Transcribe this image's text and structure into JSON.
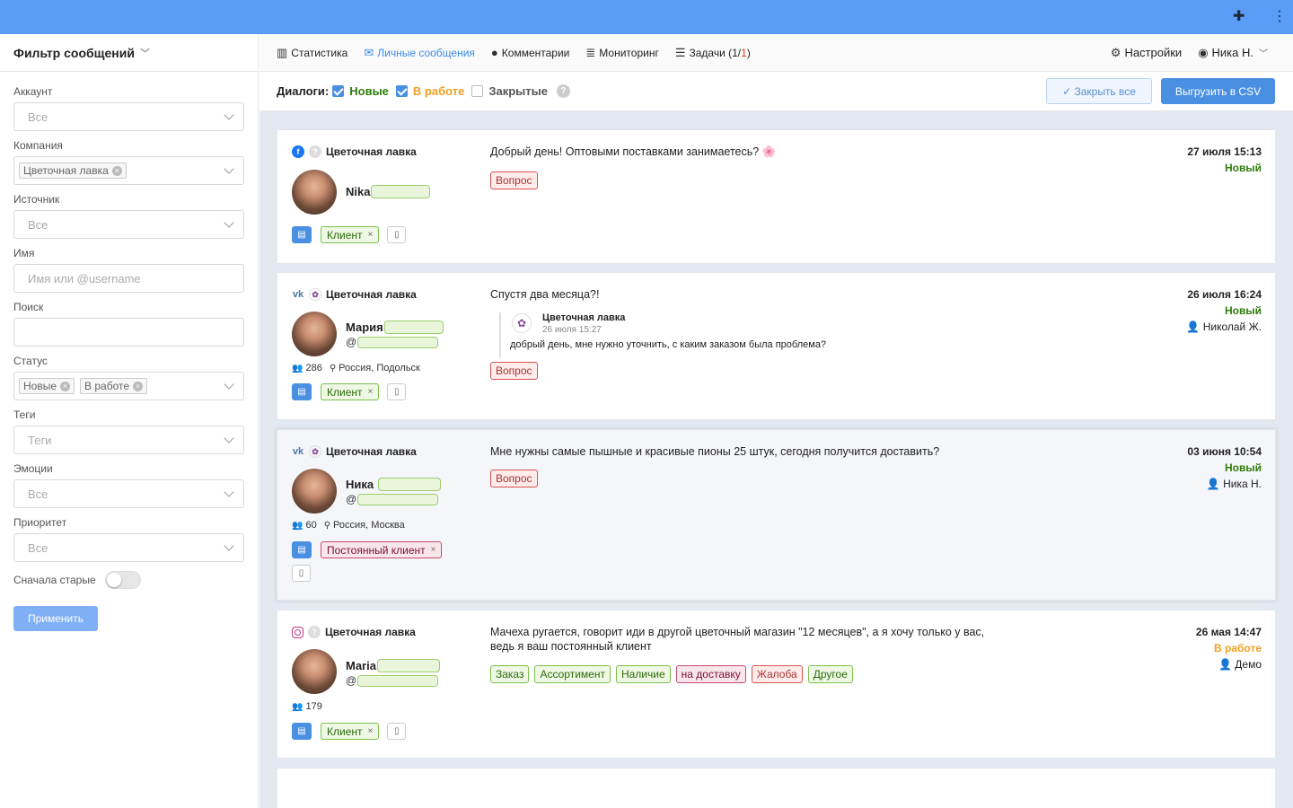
{
  "sidebar": {
    "title": "Фильтр сообщений",
    "fields": {
      "account": {
        "label": "Аккаунт",
        "value": "Все"
      },
      "company": {
        "label": "Компания",
        "chip": "Цветочная лавка"
      },
      "source": {
        "label": "Источник",
        "value": "Все"
      },
      "name": {
        "label": "Имя",
        "placeholder": "Имя или @username"
      },
      "search": {
        "label": "Поиск"
      },
      "status": {
        "label": "Статус",
        "chips": [
          "Новые",
          "В работе"
        ]
      },
      "tags": {
        "label": "Теги",
        "value": "Теги"
      },
      "emotions": {
        "label": "Эмоции",
        "value": "Все"
      },
      "priority": {
        "label": "Приоритет",
        "value": "Все"
      }
    },
    "old_first": "Сначала старые",
    "apply": "Применить"
  },
  "nav": {
    "stats": "Статистика",
    "messages": "Личные сообщения",
    "comments": "Комментарии",
    "monitoring": "Мониторинг",
    "tasks_label": "Задачи",
    "tasks_open": "(1/",
    "tasks_count": "1",
    "tasks_close": ")",
    "settings": "Настройки",
    "user": "Ника Н."
  },
  "filterbar": {
    "label": "Диалоги:",
    "opt_new": "Новые",
    "opt_work": "В работе",
    "opt_closed": "Закрытые",
    "help": "?",
    "close_all": "Закрыть все",
    "export": "Выгрузить в CSV"
  },
  "colors": {
    "topbar": "#5a9cf8",
    "accent": "#4a90e2",
    "status_new": "#2e7d0a",
    "status_work": "#f0a020",
    "tasks_count": "#d9381e"
  },
  "cards": [
    {
      "network": "facebook-icon",
      "company": "Цветочная лавка",
      "name": "Nika",
      "message": "Добрый день! Оптовыми поставками занимаетесь? 🌸",
      "tags": [
        "Вопрос"
      ],
      "client_tag": "Клиент",
      "remove": "×",
      "date": "27 июля 15:13",
      "status": "Новый"
    },
    {
      "network": "vk-icon",
      "company": "Цветочная лавка",
      "name": "Мария",
      "at": "@",
      "followers": "286",
      "location": "Россия, Подольск",
      "message": "Спустя два месяца?!",
      "reply": {
        "author": "Цветочная лавка",
        "date": "26 июля 15:27",
        "text": "добрый день, мне нужно уточнить, с каким заказом была проблема?"
      },
      "tags": [
        "Вопрос"
      ],
      "client_tag": "Клиент",
      "remove": "×",
      "date": "26 июля 16:24",
      "status": "Новый",
      "assignee": "Николай Ж."
    },
    {
      "network": "vk-icon",
      "company": "Цветочная лавка",
      "name": "Ника",
      "at": "@",
      "followers": "60",
      "location": "Россия, Москва",
      "message": "Мне нужны самые пышные и красивые пионы 25 штук, сегодня получится доставить?",
      "tags": [
        "Вопрос"
      ],
      "client_tag": "Постоянный клиент",
      "remove": "×",
      "date": "03 июня 10:54",
      "status": "Новый",
      "assignee": "Ника Н."
    },
    {
      "network": "instagram-icon",
      "company": "Цветочная лавка",
      "name": "Maria",
      "at": "@",
      "followers": "179",
      "message_line1": "Мачеха ругается, говорит иди в другой цветочный магазин \"12 месяцев\", а я хочу только у вас,",
      "message_line2": "ведь я ваш постоянный клиент",
      "tags": [
        "Заказ",
        "Ассортимент",
        "Наличие",
        "на доставку",
        "Жалоба",
        "Другое"
      ],
      "client_tag": "Клиент",
      "remove": "×",
      "date": "26 мая 14:47",
      "status": "В работе",
      "assignee": "Демо"
    }
  ]
}
